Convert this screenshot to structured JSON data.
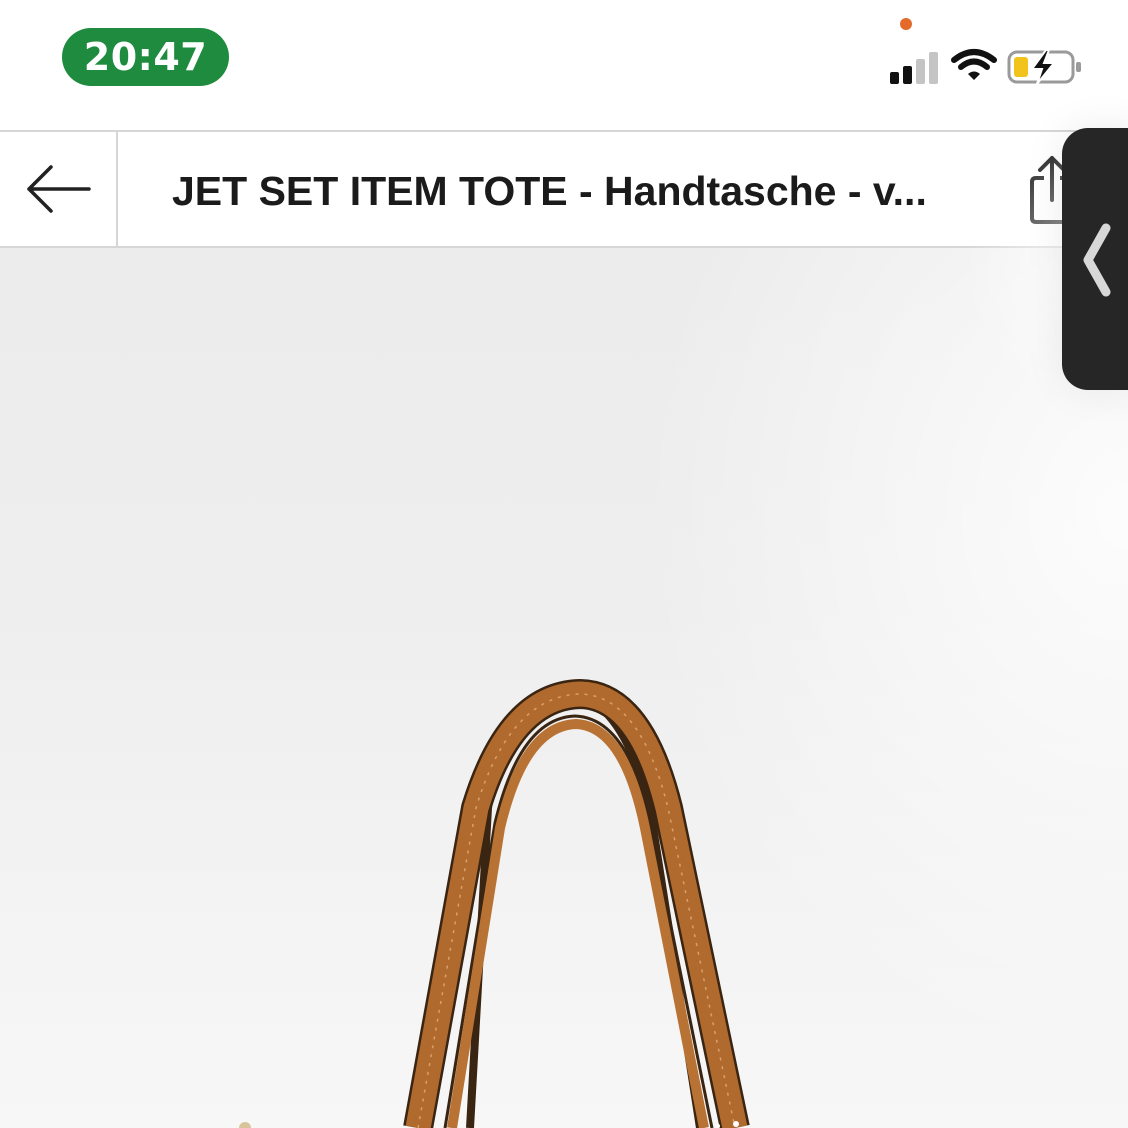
{
  "status_bar": {
    "time": "20:47",
    "signal_icon": "cellular-signal-icon",
    "wifi_icon": "wifi-icon",
    "battery_icon": "battery-charging-icon",
    "accent_color": "#1f8b3e",
    "privacy_dot_color": "#e46a2c"
  },
  "nav_bar": {
    "back_icon": "arrow-left-icon",
    "title": "JET SET ITEM TOTE - Handtasche - v...",
    "share_icon": "share-icon"
  },
  "side_handle": {
    "icon": "chevron-left-icon"
  },
  "product": {
    "image_icon": "handbag-image",
    "strap_color": "#b06a2e"
  }
}
